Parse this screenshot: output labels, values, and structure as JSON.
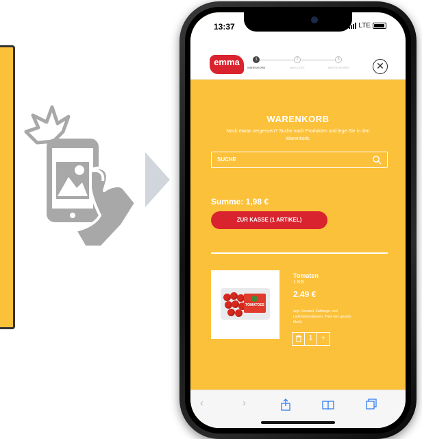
{
  "status": {
    "time": "13:37",
    "network": "LTE"
  },
  "app": {
    "logo_text": "emma",
    "steps": [
      {
        "number": "1",
        "label": "WARENKORB",
        "active": true
      },
      {
        "number": "2",
        "label": "ABHOLZEIT",
        "active": false
      },
      {
        "number": "3",
        "label": "ABSCHLIESSEN",
        "active": false
      }
    ],
    "close_icon": "close-icon"
  },
  "cart": {
    "title": "WARENKORB",
    "subtitle": "Noch etwas vergessen? Suche nach Produkten und lege Sie in den Warenkorb.",
    "search_label": "SUCHE",
    "sum_label": "Summe: 1,98 €",
    "checkout_label": "ZUR KASSE (1 ARTIKEL)"
  },
  "product": {
    "name": "Tomaten",
    "quantity": "1 KG",
    "price": "2.49 €",
    "note": "zzgl. Versand, Zahlungs- und Lieferinformationen, Preis inkl. gesetzl. MwSt.",
    "pack_label": "TOMATOES",
    "count": "1",
    "remove_icon": "trash-icon",
    "add_icon": "plus-icon"
  },
  "browser": {
    "icons": [
      "back-icon",
      "forward-icon",
      "share-icon",
      "bookmarks-icon",
      "tabs-icon"
    ]
  },
  "colors": {
    "brand_yellow": "#fcc13a",
    "brand_red": "#d9232e",
    "arrow_gray": "#d0d6dc",
    "illustration_gray": "#a8a8a8"
  }
}
